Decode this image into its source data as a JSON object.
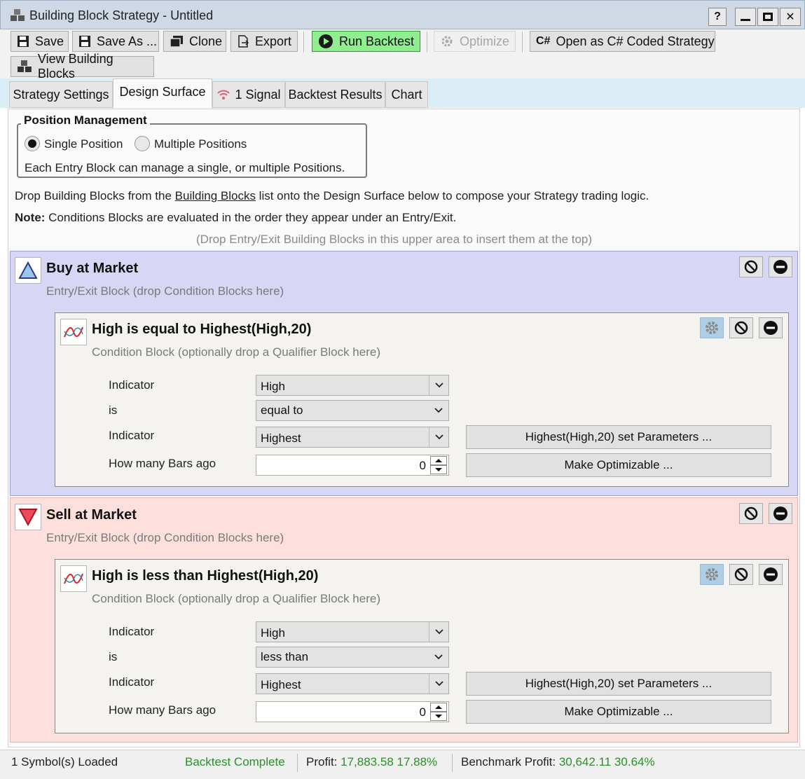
{
  "window": {
    "title": "Building Block Strategy - Untitled",
    "help_label": "?"
  },
  "toolbar": {
    "save": "Save",
    "save_as": "Save As ...",
    "clone": "Clone",
    "export": "Export",
    "run_backtest": "Run Backtest",
    "optimize": "Optimize",
    "open_csharp": "Open as C# Coded Strategy",
    "csharp_glyph": "C#",
    "view_blocks": "View Building Blocks"
  },
  "tabs": [
    "Strategy Settings",
    "Design Surface",
    "1 Signal",
    "Backtest Results",
    "Chart"
  ],
  "active_tab": "Design Surface",
  "position_management": {
    "title": "Position Management",
    "options": [
      "Single Position",
      "Multiple Positions"
    ],
    "selected": "Single Position",
    "description": "Each Entry Block can manage a single, or multiple Positions."
  },
  "instructions": {
    "line1_before": "Drop Building Blocks from the ",
    "line1_link": "Building Blocks",
    "line1_after": " list onto the Design Surface below to compose your Strategy trading logic.",
    "note_label": "Note:",
    "note_text": " Conditions Blocks are evaluated in the order they appear under an Entry/Exit.",
    "drop_hint": "(Drop Entry/Exit Building Blocks in this upper area to insert them at the top)"
  },
  "blocks": [
    {
      "title": "Buy at Market",
      "subtitle": "Entry/Exit Block (drop Condition Blocks here)",
      "condition": {
        "title": "High is equal to Highest(High,20)",
        "subtitle": "Condition Block (optionally drop a Qualifier Block here)",
        "labels": {
          "indicator1": "Indicator",
          "is": "is",
          "indicator2": "Indicator",
          "bars_ago": "How many Bars ago"
        },
        "indicator1": "High",
        "operator": "equal to",
        "indicator2": "Highest",
        "bars_ago": "0",
        "params_button": "Highest(High,20) set Parameters ...",
        "optimizable_button": "Make Optimizable ..."
      }
    },
    {
      "title": "Sell at Market",
      "subtitle": "Entry/Exit Block (drop Condition Blocks here)",
      "condition": {
        "title": "High is less than Highest(High,20)",
        "subtitle": "Condition Block (optionally drop a Qualifier Block here)",
        "labels": {
          "indicator1": "Indicator",
          "is": "is",
          "indicator2": "Indicator",
          "bars_ago": "How many Bars ago"
        },
        "indicator1": "High",
        "operator": "less than",
        "indicator2": "Highest",
        "bars_ago": "0",
        "params_button": "Highest(High,20) set Parameters ...",
        "optimizable_button": "Make Optimizable ..."
      }
    }
  ],
  "status": {
    "symbols": "1 Symbol(s) Loaded",
    "backtest": "Backtest Complete",
    "profit_label": "Profit:",
    "profit_value": "17,883.58 17.88%",
    "benchmark_label": "Benchmark Profit:",
    "benchmark_value": "30,642.11 30.64%"
  },
  "colors": {
    "buy_block_bg": "#d7d7f5",
    "sell_block_bg": "#fde0dd",
    "run_button": "#90ee90",
    "status_green": "#2a8f2a",
    "tabstrip_bg": "#dbeef7"
  }
}
